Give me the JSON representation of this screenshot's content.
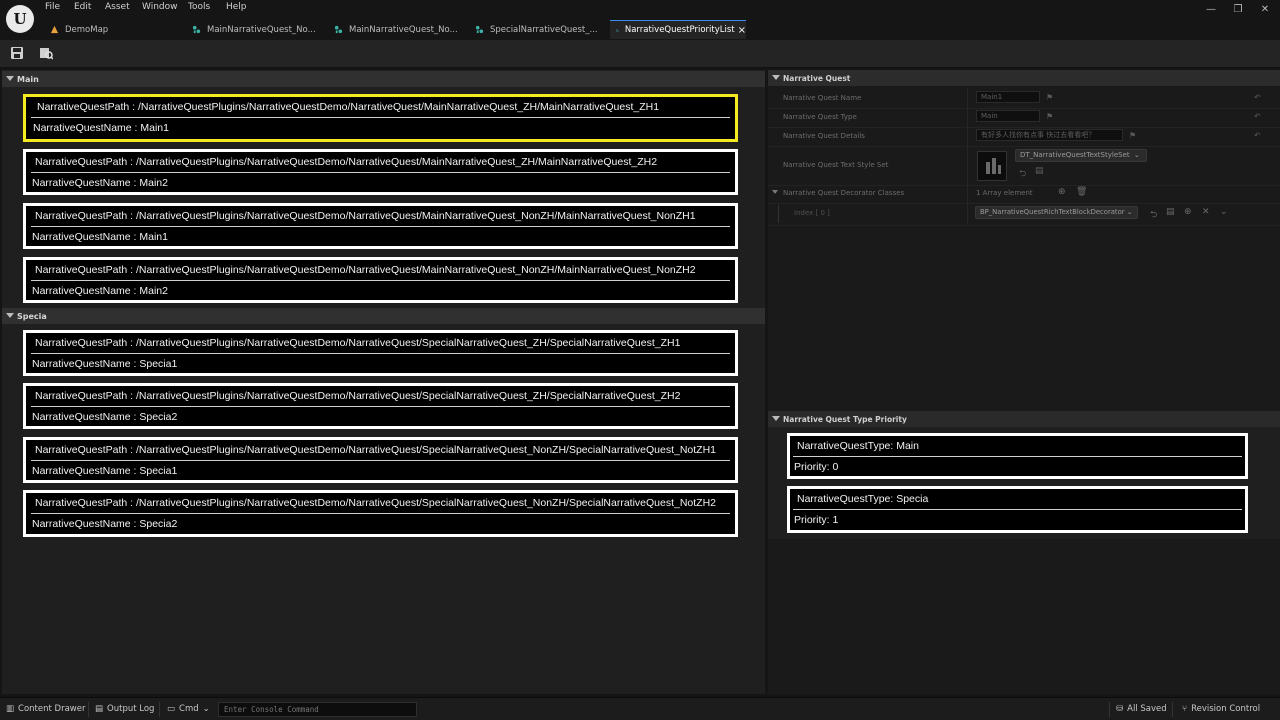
{
  "menu": [
    "File",
    "Edit",
    "Asset",
    "Window",
    "Tools",
    "Help"
  ],
  "window_buttons": {
    "minimize": "—",
    "restore": "❐",
    "close": "✕"
  },
  "tabs": [
    {
      "label": "DemoMap",
      "icon": "map-icon",
      "color": "#e8a13a"
    },
    {
      "label": "MainNarrativeQuest_No...",
      "icon": "data-asset-icon",
      "color": "#3bb3a7"
    },
    {
      "label": "MainNarrativeQuest_No...",
      "icon": "data-asset-icon",
      "color": "#3bb3a7"
    },
    {
      "label": "SpecialNarrativeQuest_...",
      "icon": "data-asset-icon",
      "color": "#3bb3a7"
    },
    {
      "label": "NarrativeQuestPriorityList",
      "icon": "data-asset-icon",
      "color": "#3bb3a7",
      "active": true,
      "close": "×"
    }
  ],
  "left": {
    "sections": [
      {
        "title": "Main"
      },
      {
        "title": "Specia"
      }
    ],
    "cards": [
      {
        "path": "NarrativeQuestPath : /NarrativeQuestPlugins/NarrativeQuestDemo/NarrativeQuest/MainNarrativeQuest_ZH/MainNarrativeQuest_ZH1",
        "name": "NarrativeQuestName : Main1"
      },
      {
        "path": "NarrativeQuestPath : /NarrativeQuestPlugins/NarrativeQuestDemo/NarrativeQuest/MainNarrativeQuest_ZH/MainNarrativeQuest_ZH2",
        "name": "NarrativeQuestName : Main2"
      },
      {
        "path": "NarrativeQuestPath : /NarrativeQuestPlugins/NarrativeQuestDemo/NarrativeQuest/MainNarrativeQuest_NonZH/MainNarrativeQuest_NonZH1",
        "name": "NarrativeQuestName : Main1"
      },
      {
        "path": "NarrativeQuestPath : /NarrativeQuestPlugins/NarrativeQuestDemo/NarrativeQuest/MainNarrativeQuest_NonZH/MainNarrativeQuest_NonZH2",
        "name": "NarrativeQuestName : Main2"
      },
      {
        "path": "NarrativeQuestPath : /NarrativeQuestPlugins/NarrativeQuestDemo/NarrativeQuest/SpecialNarrativeQuest_ZH/SpecialNarrativeQuest_ZH1",
        "name": "NarrativeQuestName : Specia1"
      },
      {
        "path": "NarrativeQuestPath : /NarrativeQuestPlugins/NarrativeQuestDemo/NarrativeQuest/SpecialNarrativeQuest_ZH/SpecialNarrativeQuest_ZH2",
        "name": "NarrativeQuestName : Specia2"
      },
      {
        "path": "NarrativeQuestPath : /NarrativeQuestPlugins/NarrativeQuestDemo/NarrativeQuest/SpecialNarrativeQuest_NonZH/SpecialNarrativeQuest_NotZH1",
        "name": "NarrativeQuestName : Specia1"
      },
      {
        "path": "NarrativeQuestPath : /NarrativeQuestPlugins/NarrativeQuestDemo/NarrativeQuest/SpecialNarrativeQuest_NonZH/SpecialNarrativeQuest_NotZH2",
        "name": "NarrativeQuestName : Specia2"
      }
    ]
  },
  "details": {
    "title": "Narrative Quest",
    "rows": [
      {
        "label": "Narrative Quest Name",
        "value": "Main1"
      },
      {
        "label": "Narrative Quest Type",
        "value": "Main"
      },
      {
        "label": "Narrative Quest Details",
        "value": "有好多人找你有点事 快过去看看吧？"
      },
      {
        "label": "Narrative Quest Text Style Set",
        "value": "DT_NarrativeQuestTextStyleSet"
      },
      {
        "label": "Narrative Quest Decorator Classes",
        "value": "1 Array element"
      },
      {
        "label": "Index [ 0 ]",
        "value": "BP_NarrativeQuestRichTextBlockDecorator"
      }
    ]
  },
  "priority": {
    "title": "Narrative Quest Type Priority",
    "items": [
      {
        "type": "NarrativeQuestType: Main",
        "priority": "Priority: 0"
      },
      {
        "type": "NarrativeQuestType: Specia",
        "priority": "Priority: 1"
      }
    ]
  },
  "statusbar": {
    "content_drawer": "Content Drawer",
    "output_log": "Output Log",
    "cmd": "Cmd",
    "console_placeholder": "Enter Console Command",
    "all_saved": "All Saved",
    "revision_control": "Revision Control"
  },
  "colors": {
    "selected_border": "#f4ea1f",
    "card_border": "#ffffff",
    "tab_accent": "#3a8cf5"
  }
}
